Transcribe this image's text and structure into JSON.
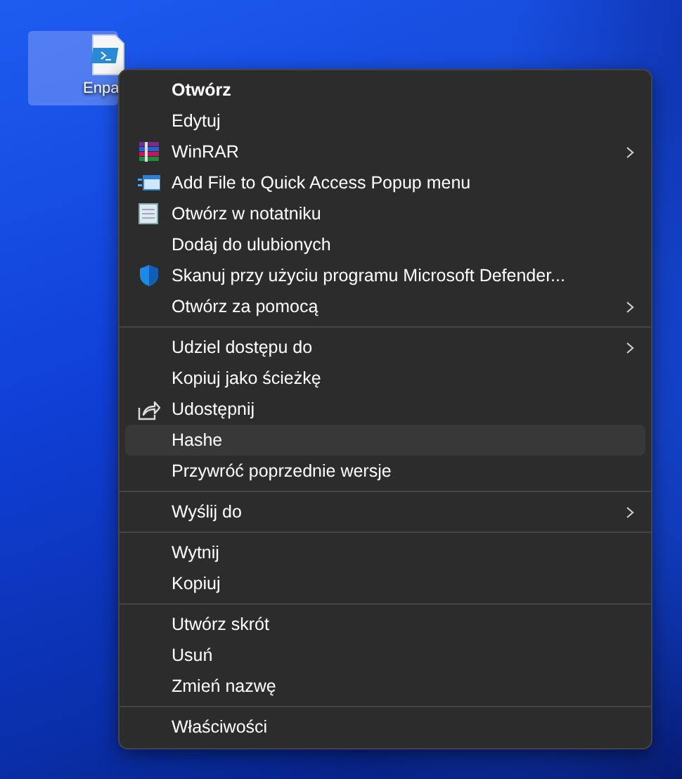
{
  "desktop": {
    "icon_label": "Enpa",
    "icon_selected": true
  },
  "context_menu": {
    "groups": [
      {
        "items": [
          {
            "label": "Otwórz",
            "bold": true,
            "kind": "plain",
            "submenu": false,
            "selected": false
          },
          {
            "label": "Edytuj",
            "bold": false,
            "kind": "plain",
            "submenu": false,
            "selected": false
          },
          {
            "label": "WinRAR",
            "bold": false,
            "kind": "archive",
            "submenu": true,
            "selected": false
          },
          {
            "label": "Add File to Quick Access Popup menu",
            "bold": false,
            "kind": "window",
            "submenu": false,
            "selected": false
          },
          {
            "label": "Otwórz w notatniku",
            "bold": false,
            "kind": "notepad",
            "submenu": false,
            "selected": false
          },
          {
            "label": "Dodaj do ulubionych",
            "bold": false,
            "kind": "plain",
            "submenu": false,
            "selected": false
          },
          {
            "label": "Skanuj przy użyciu programu Microsoft Defender...",
            "bold": false,
            "kind": "shield",
            "submenu": false,
            "selected": false
          },
          {
            "label": "Otwórz za pomocą",
            "bold": false,
            "kind": "plain",
            "submenu": true,
            "selected": false
          }
        ]
      },
      {
        "items": [
          {
            "label": "Udziel dostępu do",
            "bold": false,
            "kind": "plain",
            "submenu": true,
            "selected": false
          },
          {
            "label": "Kopiuj jako ścieżkę",
            "bold": false,
            "kind": "plain",
            "submenu": false,
            "selected": false
          },
          {
            "label": "Udostępnij",
            "bold": false,
            "kind": "share",
            "submenu": false,
            "selected": false
          },
          {
            "label": "Hashe",
            "bold": false,
            "kind": "plain",
            "submenu": false,
            "selected": true
          },
          {
            "label": "Przywróć poprzednie wersje",
            "bold": false,
            "kind": "plain",
            "submenu": false,
            "selected": false
          }
        ]
      },
      {
        "items": [
          {
            "label": "Wyślij do",
            "bold": false,
            "kind": "plain",
            "submenu": true,
            "selected": false
          }
        ]
      },
      {
        "items": [
          {
            "label": "Wytnij",
            "bold": false,
            "kind": "plain",
            "submenu": false,
            "selected": false
          },
          {
            "label": "Kopiuj",
            "bold": false,
            "kind": "plain",
            "submenu": false,
            "selected": false
          }
        ]
      },
      {
        "items": [
          {
            "label": "Utwórz skrót",
            "bold": false,
            "kind": "plain",
            "submenu": false,
            "selected": false
          },
          {
            "label": "Usuń",
            "bold": false,
            "kind": "plain",
            "submenu": false,
            "selected": false
          },
          {
            "label": "Zmień nazwę",
            "bold": false,
            "kind": "plain",
            "submenu": false,
            "selected": false
          }
        ]
      },
      {
        "items": [
          {
            "label": "Właściwości",
            "bold": false,
            "kind": "plain",
            "submenu": false,
            "selected": false
          }
        ]
      }
    ]
  }
}
